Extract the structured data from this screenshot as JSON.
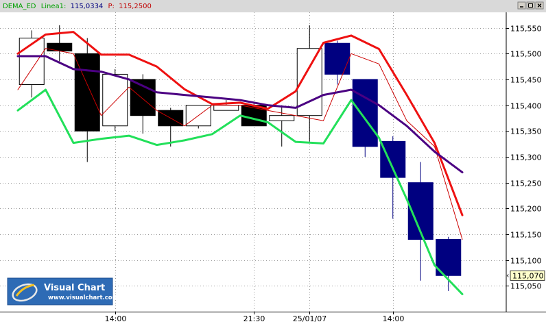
{
  "chart_data": {
    "type": "candlestick",
    "legend": [
      {
        "label": "DEMA_ED",
        "color": "#00a000"
      },
      {
        "label": "Linea1:",
        "color": "#00a000"
      },
      {
        "label": "115,0334",
        "color": "#000080"
      },
      {
        "label": "P:",
        "color": "#c00000"
      },
      {
        "label": "115,2500",
        "color": "#c00000"
      }
    ],
    "ylim": [
      115.0,
      115.58
    ],
    "y_ticks": [
      "115,550",
      "115,500",
      "115,450",
      "115,400",
      "115,350",
      "115,300",
      "115,250",
      "115,200",
      "115,150",
      "115,100",
      "115,050"
    ],
    "y_tick_values": [
      115.55,
      115.5,
      115.45,
      115.4,
      115.35,
      115.3,
      115.25,
      115.2,
      115.15,
      115.1,
      115.05
    ],
    "x_ticks": [
      {
        "label": "14:00",
        "slot": 3.5
      },
      {
        "label": "21:30",
        "slot": 8.5
      },
      {
        "label": "25/01/07",
        "slot": 10.5
      },
      {
        "label": "14:00",
        "slot": 13.5
      }
    ],
    "last_price_label": "115,070",
    "last_price_value": 115.07,
    "candles": [
      {
        "o": 115.44,
        "h": 115.545,
        "l": 115.415,
        "c": 115.53,
        "color": "white"
      },
      {
        "o": 115.52,
        "h": 115.555,
        "l": 115.485,
        "c": 115.505,
        "color": "black"
      },
      {
        "o": 115.5,
        "h": 115.53,
        "l": 115.29,
        "c": 115.35,
        "color": "black"
      },
      {
        "o": 115.36,
        "h": 115.47,
        "l": 115.35,
        "c": 115.46,
        "color": "white"
      },
      {
        "o": 115.45,
        "h": 115.46,
        "l": 115.345,
        "c": 115.38,
        "color": "black"
      },
      {
        "o": 115.39,
        "h": 115.395,
        "l": 115.32,
        "c": 115.36,
        "color": "black"
      },
      {
        "o": 115.36,
        "h": 115.4,
        "l": 115.355,
        "c": 115.4,
        "color": "white"
      },
      {
        "o": 115.39,
        "h": 115.41,
        "l": 115.39,
        "c": 115.4,
        "color": "white"
      },
      {
        "o": 115.4,
        "h": 115.405,
        "l": 115.36,
        "c": 115.36,
        "color": "black"
      },
      {
        "o": 115.38,
        "h": 115.4,
        "l": 115.32,
        "c": 115.37,
        "color": "white"
      },
      {
        "o": 115.38,
        "h": 115.555,
        "l": 115.33,
        "c": 115.51,
        "color": "white"
      },
      {
        "o": 115.52,
        "h": 115.525,
        "l": 115.44,
        "c": 115.46,
        "color": "navy"
      },
      {
        "o": 115.45,
        "h": 115.45,
        "l": 115.3,
        "c": 115.32,
        "color": "navy"
      },
      {
        "o": 115.33,
        "h": 115.34,
        "l": 115.18,
        "c": 115.26,
        "color": "navy"
      },
      {
        "o": 115.25,
        "h": 115.29,
        "l": 115.06,
        "c": 115.14,
        "color": "navy"
      },
      {
        "o": 115.14,
        "h": 115.145,
        "l": 115.04,
        "c": 115.07,
        "color": "navy"
      }
    ],
    "series": [
      {
        "color": "#ee1111",
        "width": 3,
        "values": [
          115.5,
          115.537,
          115.542,
          115.498,
          115.498,
          115.475,
          115.431,
          115.402,
          115.405,
          115.393,
          115.427,
          115.521,
          115.535,
          115.509,
          115.42,
          115.327,
          115.187
        ]
      },
      {
        "color": "#cc0000",
        "width": 1,
        "values": [
          115.43,
          115.51,
          115.5,
          115.38,
          115.435,
          115.39,
          115.36,
          115.4,
          115.4,
          115.39,
          115.38,
          115.37,
          115.5,
          115.48,
          115.37,
          115.32,
          115.14
        ]
      },
      {
        "color": "#4b0082",
        "width": 3,
        "values": [
          115.495,
          115.495,
          115.47,
          115.465,
          115.45,
          115.425,
          115.42,
          115.415,
          115.41,
          115.4,
          115.395,
          115.42,
          115.43,
          115.4,
          115.36,
          115.31,
          115.27
        ]
      },
      {
        "color": "#22e05a",
        "width": 3,
        "values": [
          115.39,
          115.43,
          115.327,
          115.335,
          115.341,
          115.323,
          115.332,
          115.344,
          115.38,
          115.367,
          115.329,
          115.326,
          115.41,
          115.337,
          115.218,
          115.09,
          115.034
        ]
      }
    ]
  },
  "branding": {
    "name": "Visual Chart",
    "url": "www.visualchart.com"
  }
}
